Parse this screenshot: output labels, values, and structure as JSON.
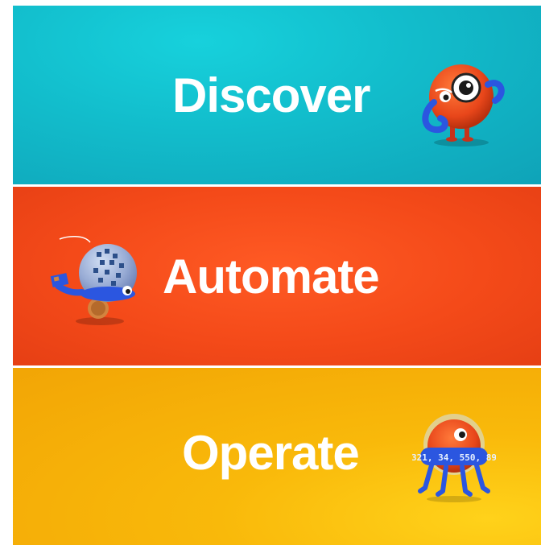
{
  "panels": [
    {
      "label": "Discover",
      "color": "#12bccb",
      "mascot": "robot-with-magnifier-icon"
    },
    {
      "label": "Automate",
      "color": "#f44a19",
      "mascot": "robot-with-circuit-dome-icon"
    },
    {
      "label": "Operate",
      "color": "#f9b90a",
      "mascot": "robot-with-number-ring-icon"
    }
  ],
  "operate_ring_text": "321, 34, 550, 89"
}
